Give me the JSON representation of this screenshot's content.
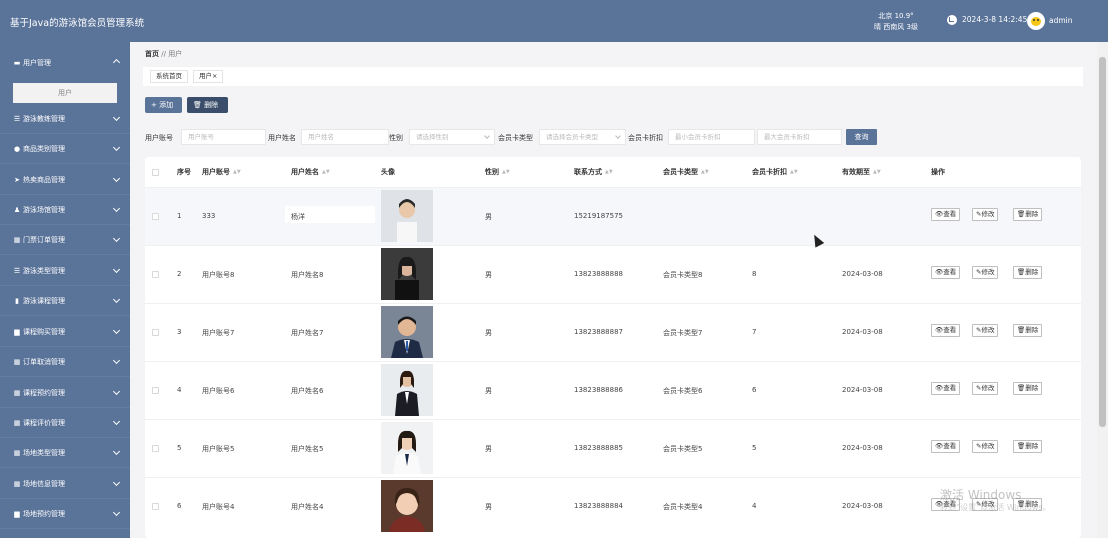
{
  "header": {
    "title": "基于Java的游泳馆会员管理系统",
    "weather_line1": "北京 10.9°",
    "weather_line2": "晴 西南风 3级",
    "datetime": "2024-3-8 14:2:45",
    "username": "admin"
  },
  "sidebar": {
    "items": [
      {
        "label": "用户管理",
        "icon": "person-card-icon"
      },
      {
        "label": "游泳教练管理",
        "icon": "list-icon"
      },
      {
        "label": "商品类别管理",
        "icon": "tag-icon"
      },
      {
        "label": "热卖商品管理",
        "icon": "send-icon"
      },
      {
        "label": "游泳场馆管理",
        "icon": "user-icon"
      },
      {
        "label": "门票订单管理",
        "icon": "grid-icon"
      },
      {
        "label": "游泳类型管理",
        "icon": "list-icon"
      },
      {
        "label": "游泳课程管理",
        "icon": "bar-icon"
      },
      {
        "label": "课程购买管理",
        "icon": "box-icon"
      },
      {
        "label": "订单取消管理",
        "icon": "grid-icon"
      },
      {
        "label": "课程预约管理",
        "icon": "grid-icon"
      },
      {
        "label": "课程评价管理",
        "icon": "grid-icon"
      },
      {
        "label": "场地类型管理",
        "icon": "grid-icon"
      },
      {
        "label": "场地信息管理",
        "icon": "grid-icon"
      },
      {
        "label": "场地预约管理",
        "icon": "box-icon"
      }
    ],
    "sub_item": "用户"
  },
  "breadcrumb": {
    "home": "首页",
    "sep": "//",
    "current": "用户"
  },
  "tabs": [
    "系统首页",
    "用户"
  ],
  "tab_close": "×",
  "toolbar": {
    "add": "+ 添加",
    "delete": "删除"
  },
  "filters": {
    "account_label": "用户账号",
    "account_ph": "用户账号",
    "name_label": "用户姓名",
    "name_ph": "用户姓名",
    "gender_label": "性别",
    "gender_ph": "请选择性别",
    "card_type_label": "会员卡类型",
    "card_type_ph": "请选择会员卡类型",
    "discount_label": "会员卡折扣",
    "discount_min_ph": "最小会员卡折扣",
    "discount_max_ph": "最大会员卡折扣",
    "search": "查询"
  },
  "table": {
    "headers": [
      "序号",
      "用户账号",
      "用户姓名",
      "头像",
      "性别",
      "联系方式",
      "会员卡类型",
      "会员卡折扣",
      "有效期至",
      "操作"
    ],
    "actions": [
      "查看",
      "修改",
      "删除"
    ],
    "rows": [
      {
        "idx": "1",
        "account": "333",
        "name": "杨洋",
        "gender": "男",
        "phone": "15219187575",
        "card": "",
        "discount": "",
        "expire": ""
      },
      {
        "idx": "2",
        "account": "用户账号8",
        "name": "用户姓名8",
        "gender": "男",
        "phone": "13823888888",
        "card": "会员卡类型8",
        "discount": "8",
        "expire": "2024-03-08"
      },
      {
        "idx": "3",
        "account": "用户账号7",
        "name": "用户姓名7",
        "gender": "男",
        "phone": "13823888887",
        "card": "会员卡类型7",
        "discount": "7",
        "expire": "2024-03-08"
      },
      {
        "idx": "4",
        "account": "用户账号6",
        "name": "用户姓名6",
        "gender": "男",
        "phone": "13823888886",
        "card": "会员卡类型6",
        "discount": "6",
        "expire": "2024-03-08"
      },
      {
        "idx": "5",
        "account": "用户账号5",
        "name": "用户姓名5",
        "gender": "男",
        "phone": "13823888885",
        "card": "会员卡类型5",
        "discount": "5",
        "expire": "2024-03-08"
      },
      {
        "idx": "6",
        "account": "用户账号4",
        "name": "用户姓名4",
        "gender": "男",
        "phone": "13823888884",
        "card": "会员卡类型4",
        "discount": "4",
        "expire": "2024-03-08"
      }
    ]
  },
  "watermark": {
    "line1": "激活 Windows",
    "line2": "转到“设置”以激活 Windows。"
  }
}
